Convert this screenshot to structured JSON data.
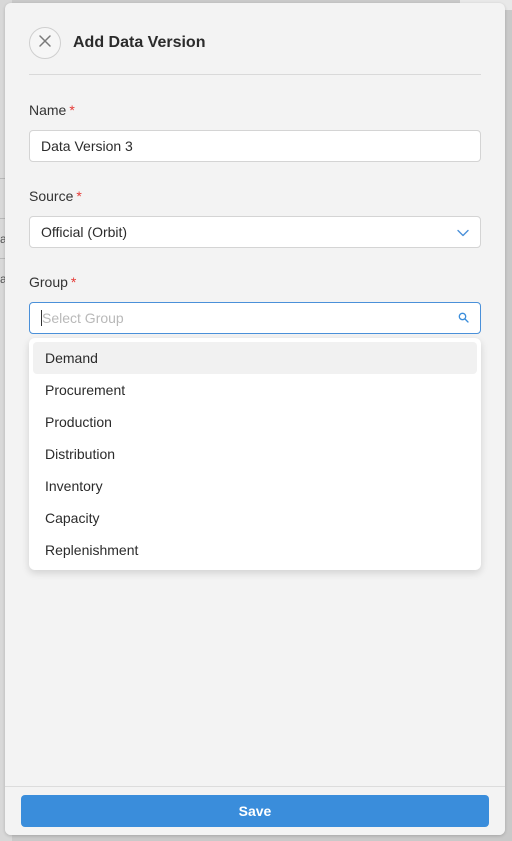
{
  "background": {
    "fragments": [
      "ay",
      "ay"
    ]
  },
  "dialog": {
    "title": "Add Data Version",
    "close_icon": "close-icon"
  },
  "form": {
    "name": {
      "label": "Name",
      "required_mark": "*",
      "value": "Data Version 3"
    },
    "source": {
      "label": "Source",
      "required_mark": "*",
      "selected": "Official (Orbit)",
      "icon": "chevron-down-icon"
    },
    "group": {
      "label": "Group",
      "required_mark": "*",
      "placeholder": "Select Group",
      "value": "",
      "icon": "search-icon",
      "options": [
        {
          "label": "Demand",
          "highlighted": true
        },
        {
          "label": "Procurement",
          "highlighted": false
        },
        {
          "label": "Production",
          "highlighted": false
        },
        {
          "label": "Distribution",
          "highlighted": false
        },
        {
          "label": "Inventory",
          "highlighted": false
        },
        {
          "label": "Capacity",
          "highlighted": false
        },
        {
          "label": "Replenishment",
          "highlighted": false
        }
      ]
    }
  },
  "footer": {
    "save_label": "Save"
  },
  "colors": {
    "accent": "#3a8ddb",
    "required": "#e53935",
    "focus_border": "#4a90d9"
  }
}
